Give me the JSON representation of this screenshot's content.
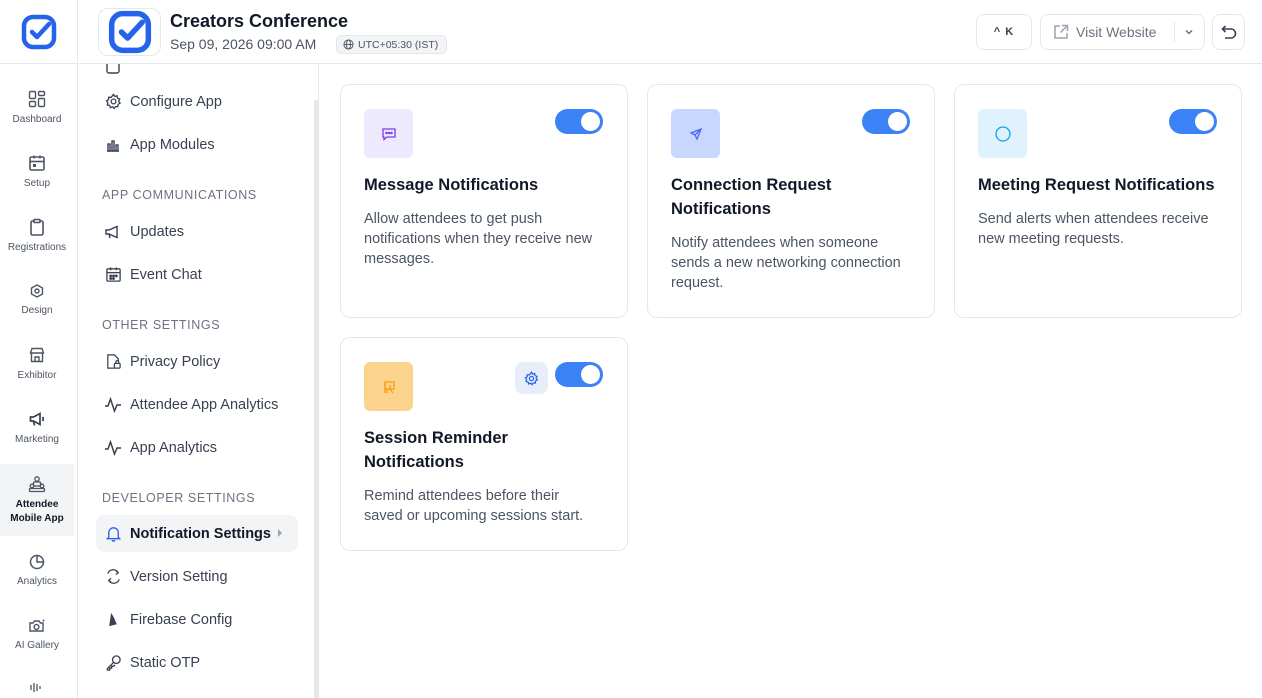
{
  "header": {
    "event_title": "Creators Conference",
    "event_date": "Sep 09, 2026 09:00 AM",
    "timezone": "UTC+05:30 (IST)",
    "shortcut_label": "^ K",
    "visit_website_label": "Visit Website"
  },
  "rail": {
    "items": [
      {
        "label": "Dashboard",
        "icon": "grid-icon"
      },
      {
        "label": "Setup",
        "icon": "calendar-icon"
      },
      {
        "label": "Registrations",
        "icon": "clipboard-icon"
      },
      {
        "label": "Design",
        "icon": "palette-icon"
      },
      {
        "label": "Exhibitor",
        "icon": "store-icon"
      },
      {
        "label": "Marketing",
        "icon": "megaphone-icon"
      },
      {
        "label": "Attendee Mobile App",
        "icon": "people-icon"
      },
      {
        "label": "Analytics",
        "icon": "pie-chart-icon"
      },
      {
        "label": "AI Gallery",
        "icon": "camera-icon"
      }
    ]
  },
  "sidebar": {
    "items_top": [
      {
        "label": "Configure App",
        "icon": "gear-icon"
      },
      {
        "label": "App Modules",
        "icon": "bar-chart-icon"
      }
    ],
    "app_communications": {
      "heading": "APP COMMUNICATIONS",
      "items": [
        {
          "label": "Updates",
          "icon": "megaphone-icon"
        },
        {
          "label": "Event Chat",
          "icon": "calendar-icon"
        }
      ]
    },
    "other_settings": {
      "heading": "OTHER SETTINGS",
      "items": [
        {
          "label": "Privacy Policy",
          "icon": "file-lock-icon"
        },
        {
          "label": "Attendee App Analytics",
          "icon": "activity-icon"
        },
        {
          "label": "App Analytics",
          "icon": "activity-icon"
        }
      ]
    },
    "developer_settings": {
      "heading": "DEVELOPER SETTINGS",
      "items": [
        {
          "label": "Notification Settings",
          "icon": "bell-icon"
        },
        {
          "label": "Version Setting",
          "icon": "refresh-icon"
        },
        {
          "label": "Firebase Config",
          "icon": "flame-icon"
        },
        {
          "label": "Static OTP",
          "icon": "key-icon"
        }
      ]
    }
  },
  "cards": [
    {
      "title": "Message Notifications",
      "description": "Allow attendees to get push notifications when they receive new messages.",
      "enabled": true,
      "icon": "message-icon",
      "icon_bg": "#ede9fe",
      "icon_color": "#7c3aed"
    },
    {
      "title": "Connection Request Notifications",
      "description": "Notify attendees when someone sends a new networking connection request.",
      "enabled": true,
      "icon": "send-icon",
      "icon_bg": "#c7d7fe",
      "icon_color": "#4f6bed"
    },
    {
      "title": "Meeting Request Notifications",
      "description": "Send alerts when attendees receive new meeting requests.",
      "enabled": true,
      "icon": "circle-icon",
      "icon_bg": "#e0f2fe",
      "icon_color": "#0ea5e9"
    },
    {
      "title": "Session Reminder Notifications",
      "description": "Remind attendees before their saved or upcoming sessions start.",
      "enabled": true,
      "icon": "presentation-icon",
      "icon_bg": "#fcd38d",
      "icon_color": "#f59e0b"
    }
  ],
  "colors": {
    "accent": "#3b82f6",
    "brand": "#2563eb"
  }
}
